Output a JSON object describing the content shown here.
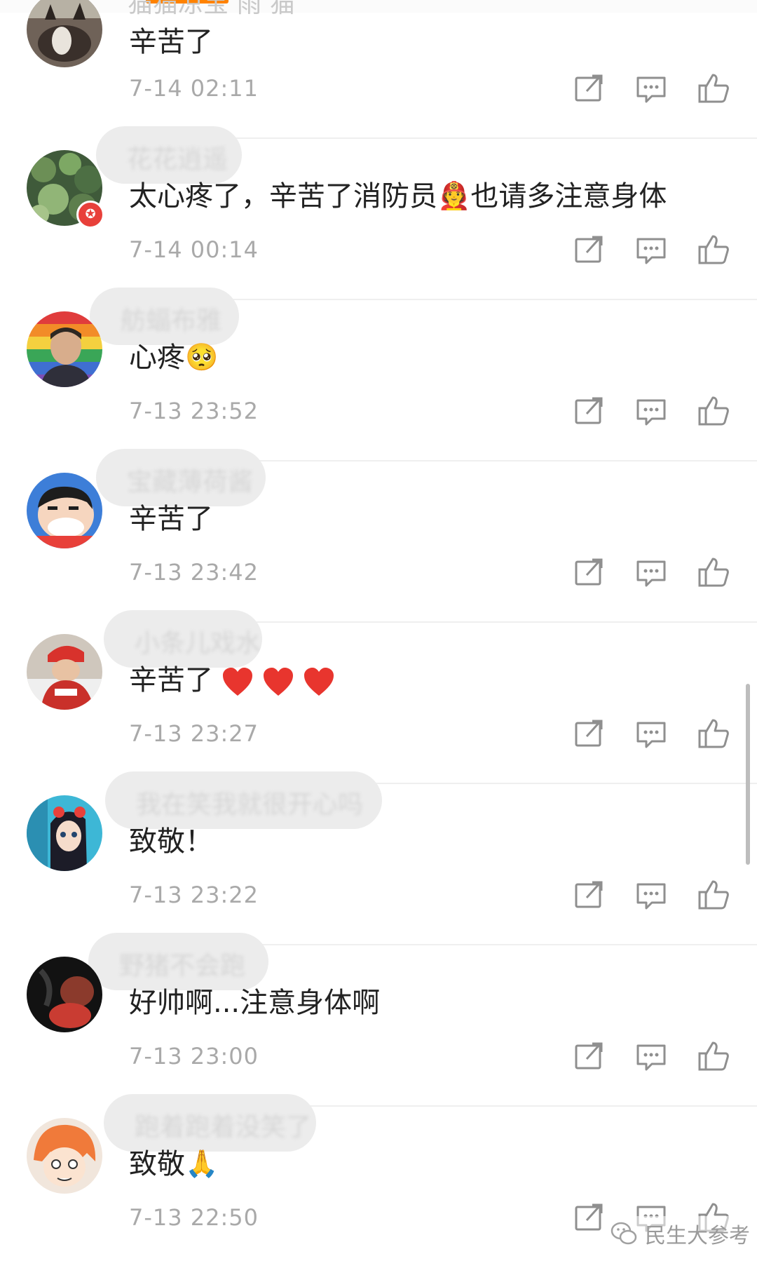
{
  "top": {
    "cut_username": "猫猫凉宝 雨 猫"
  },
  "comments": [
    {
      "username": "",
      "text": "辛苦了",
      "time": "7-14 02:11",
      "avatar": "avatar-cat"
    },
    {
      "username": "花花逍遥",
      "text": "太心疼了，辛苦了消防员",
      "text_after": "也请多注意身体",
      "emoji": "🧑‍🚒",
      "time": "7-14 00:14",
      "avatar": "avatar-plants",
      "badge": "vip-badge"
    },
    {
      "username": "舫蝠布雅",
      "text": "心疼",
      "emoji": "🥺",
      "time": "7-13 23:52",
      "avatar": "avatar-man-rainbow"
    },
    {
      "username": "宝藏薄荷酱",
      "text": "辛苦了",
      "time": "7-13 23:42",
      "avatar": "avatar-crayon-shin"
    },
    {
      "username": "小条儿戏水",
      "text": "辛苦了",
      "hearts": 3,
      "time": "7-13 23:27",
      "avatar": "avatar-child-red-hat"
    },
    {
      "username": "我在笑我就很开心吗",
      "text": "致敬！",
      "time": "7-13 23:22",
      "avatar": "avatar-anime-girl"
    },
    {
      "username": "野猪不会跑",
      "text": "好帅啊...注意身体啊",
      "time": "7-13 23:00",
      "avatar": "avatar-dark-photo"
    },
    {
      "username": "跑着跑着没笑了",
      "text": "致敬",
      "emoji": "🙏",
      "time": "7-13 22:50",
      "avatar": "avatar-anime-orange-hair"
    }
  ],
  "actions": {
    "repost_icon": "repost-icon",
    "reply_icon": "comment-icon",
    "like_icon": "thumbs-up-icon"
  },
  "watermark": {
    "text": "民生大参考",
    "icon": "wechat-icon"
  },
  "colors": {
    "accent": "#ff8200",
    "text": "#222222",
    "meta": "#a9a9a9",
    "icon": "#8f8f8f",
    "heart": "#e8352e"
  }
}
